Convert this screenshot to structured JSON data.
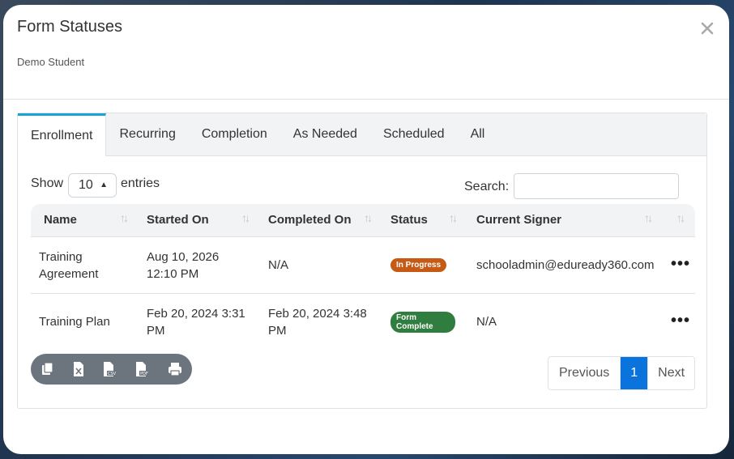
{
  "modal": {
    "title": "Form Statuses",
    "subtitle": "Demo Student",
    "close_icon": "close-icon"
  },
  "tabs": [
    {
      "label": "Enrollment",
      "active": true
    },
    {
      "label": "Recurring",
      "active": false
    },
    {
      "label": "Completion",
      "active": false
    },
    {
      "label": "As Needed",
      "active": false
    },
    {
      "label": "Scheduled",
      "active": false
    },
    {
      "label": "All",
      "active": false
    }
  ],
  "controls": {
    "show_label": "Show",
    "entries_value": "10",
    "entries_label": "entries",
    "search_label": "Search:",
    "search_value": ""
  },
  "table": {
    "columns": [
      "Name",
      "Started On",
      "Completed On",
      "Status",
      "Current Signer"
    ],
    "rows": [
      {
        "name": "Training Agreement",
        "started_on": "Aug 10, 2026 12:10 PM",
        "completed_on": "N/A",
        "status": "In Progress",
        "current_signer": "schooladmin@eduready360.com"
      },
      {
        "name": "Training Plan",
        "started_on": "Feb 20, 2024 3:31 PM",
        "completed_on": "Feb 20, 2024 3:48 PM",
        "status": "Form Complete",
        "current_signer": "N/A"
      }
    ]
  },
  "export_buttons": [
    "copy-icon",
    "excel-icon",
    "csv-icon",
    "pdf-icon",
    "print-icon"
  ],
  "pagination": {
    "previous": "Previous",
    "current": "1",
    "next": "Next"
  },
  "colors": {
    "accent": "#17a2d8",
    "in_progress": "#c65a15",
    "complete": "#2f7d3f",
    "page_active": "#0a74dc"
  }
}
